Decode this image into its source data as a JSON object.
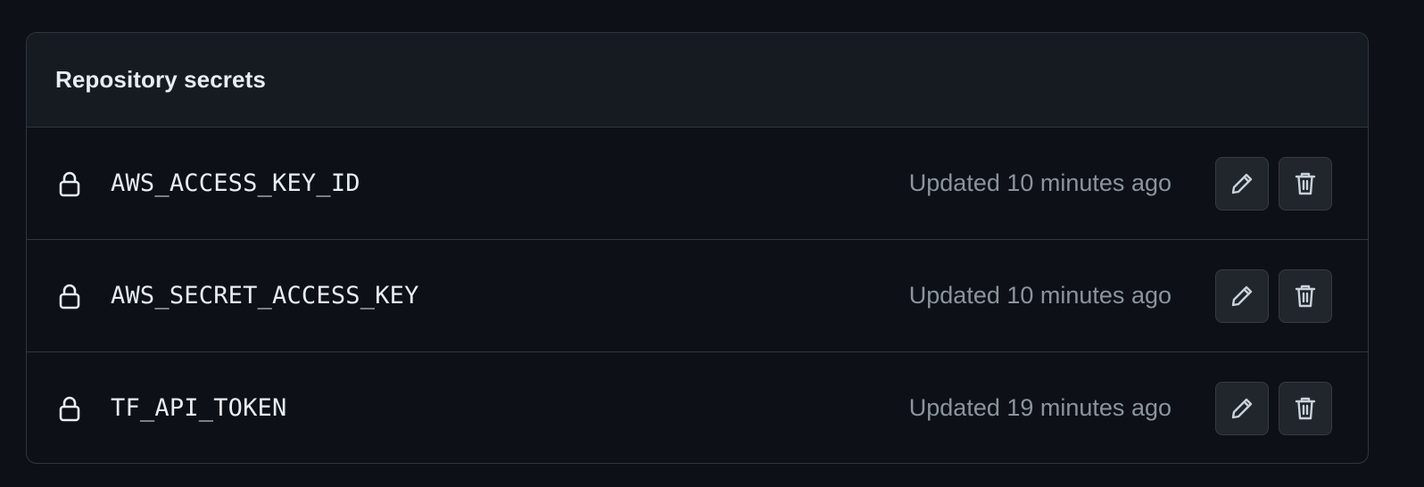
{
  "panel": {
    "title": "Repository secrets"
  },
  "secrets": [
    {
      "name": "AWS_ACCESS_KEY_ID",
      "updated": "Updated 10 minutes ago"
    },
    {
      "name": "AWS_SECRET_ACCESS_KEY",
      "updated": "Updated 10 minutes ago"
    },
    {
      "name": "TF_API_TOKEN",
      "updated": "Updated 19 minutes ago"
    }
  ],
  "icons": {
    "row_icon": "lock-icon",
    "edit": "pencil-icon",
    "delete": "trash-icon"
  },
  "colors": {
    "background": "#0d1117",
    "header_bg": "#161b22",
    "border": "#30363d",
    "text": "#e6edf3",
    "muted_text": "#8b949e",
    "button_bg": "#21262d"
  }
}
